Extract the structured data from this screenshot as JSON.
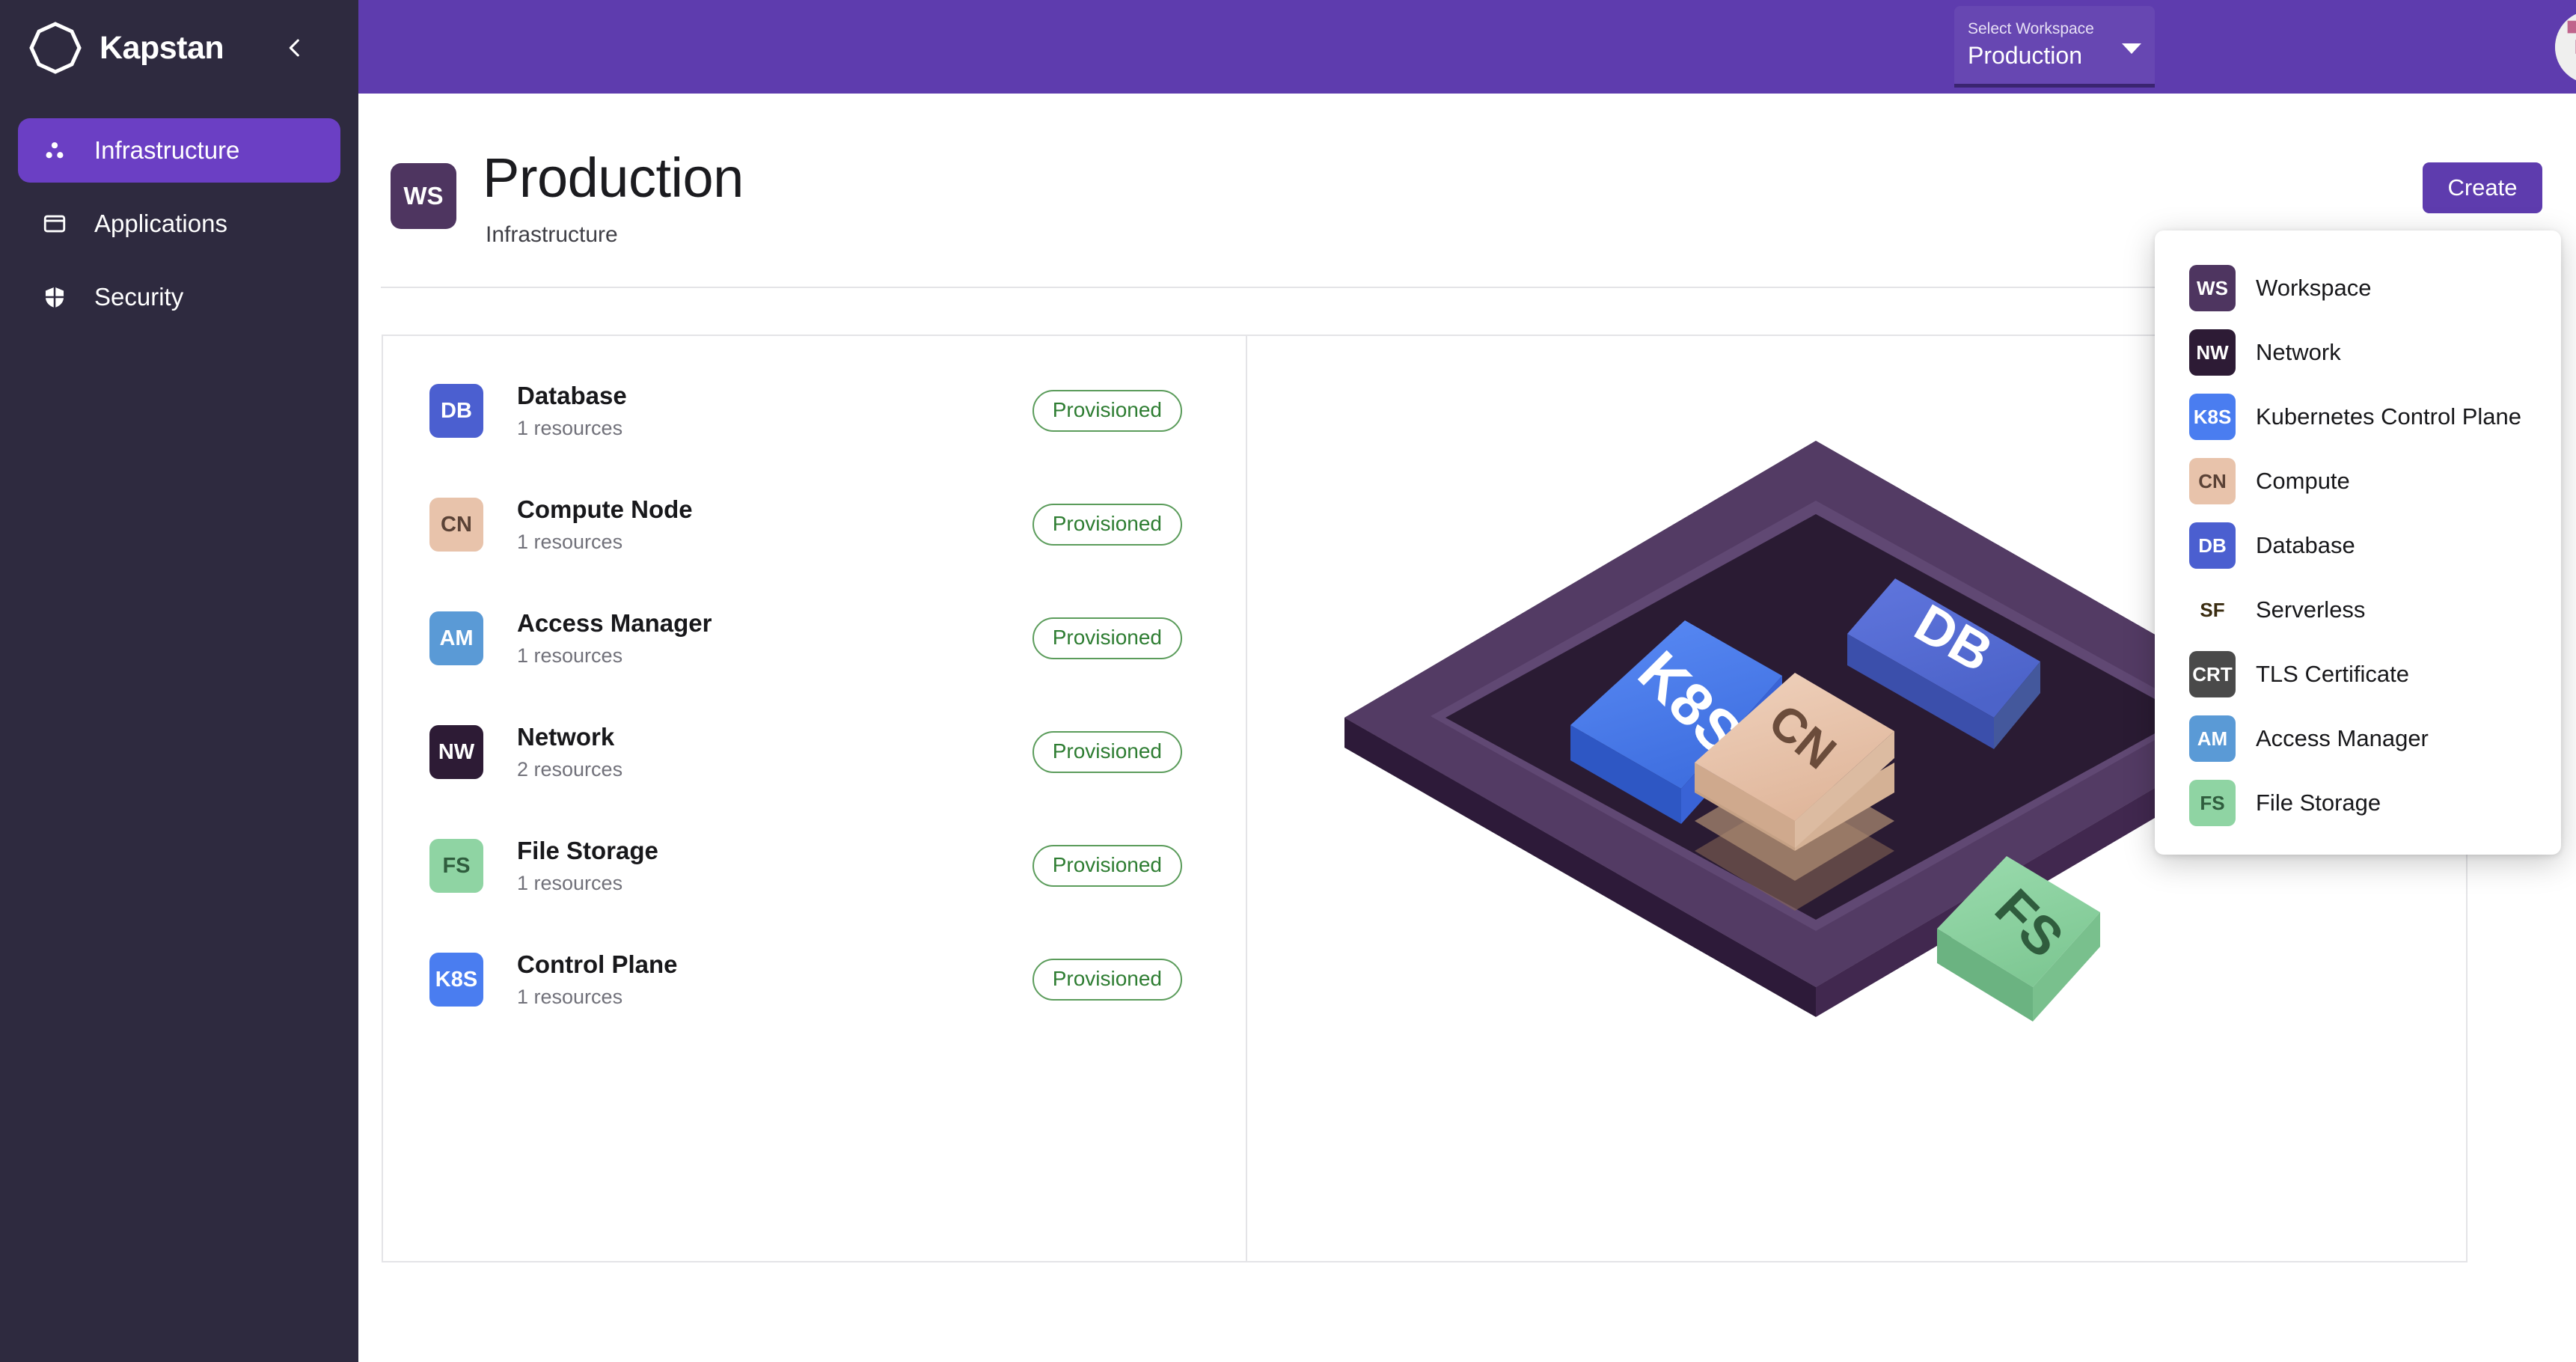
{
  "brand": {
    "name": "Kapstan",
    "logo_icon": "hexagon-ring-logo",
    "collapse_icon": "chevron-left-icon"
  },
  "sidebar": {
    "items": [
      {
        "label": "Infrastructure",
        "icon": "three-dots-cluster-icon",
        "active": true
      },
      {
        "label": "Applications",
        "icon": "window-icon",
        "active": false
      },
      {
        "label": "Security",
        "icon": "shield-icon",
        "active": false
      }
    ]
  },
  "header": {
    "workspace_label": "Select Workspace",
    "workspace_value": "Production",
    "caret_icon": "chevron-down-icon",
    "avatar_icon": "user-identicon-avatar",
    "bar_color": "#5e3cae"
  },
  "page": {
    "badge": "WS",
    "title": "Production",
    "subtitle": "Infrastructure",
    "create_label": "Create"
  },
  "resources": {
    "items": [
      {
        "badge": "DB",
        "name": "Database",
        "count": "1 resources",
        "status": "Provisioned",
        "badge_bg": "#4b5fd0",
        "badge_fg": "#ffffff"
      },
      {
        "badge": "CN",
        "name": "Compute Node",
        "count": "1 resources",
        "status": "Provisioned",
        "badge_bg": "#e8c3ab",
        "badge_fg": "#5a4236"
      },
      {
        "badge": "AM",
        "name": "Access Manager",
        "count": "1 resources",
        "status": "Provisioned",
        "badge_bg": "#5a9ad6",
        "badge_fg": "#ffffff"
      },
      {
        "badge": "NW",
        "name": "Network",
        "count": "2 resources",
        "status": "Provisioned",
        "badge_bg": "#2d1b35",
        "badge_fg": "#ffffff"
      },
      {
        "badge": "FS",
        "name": "File Storage",
        "count": "1 resources",
        "status": "Provisioned",
        "badge_bg": "#8fd4a3",
        "badge_fg": "#2f5c3d"
      },
      {
        "badge": "K8S",
        "name": "Control Plane",
        "count": "1 resources",
        "status": "Provisioned",
        "badge_bg": "#4a7df0",
        "badge_fg": "#ffffff"
      }
    ],
    "status_color": "#2e7d32"
  },
  "create_menu": {
    "items": [
      {
        "badge": "WS",
        "label": "Workspace",
        "badge_bg": "#4e3560",
        "badge_fg": "#ffffff"
      },
      {
        "badge": "NW",
        "label": "Network",
        "badge_bg": "#2d1b35",
        "badge_fg": "#ffffff"
      },
      {
        "badge": "K8S",
        "label": "Kubernetes Control Plane",
        "badge_bg": "#4a7df0",
        "badge_fg": "#ffffff"
      },
      {
        "badge": "CN",
        "label": "Compute",
        "badge_bg": "#e8c3ab",
        "badge_fg": "#5a4236"
      },
      {
        "badge": "DB",
        "label": "Database",
        "badge_bg": "#4b5fd0",
        "badge_fg": "#ffffff"
      },
      {
        "badge": "SF",
        "label": "Serverless",
        "badge_bg": "#f5c濃66",
        "badge_fg": "#3a2c10"
      },
      {
        "badge": "CRT",
        "label": "TLS Certificate",
        "badge_bg": "#4a4a4a",
        "badge_fg": "#ffffff"
      },
      {
        "badge": "AM",
        "label": "Access Manager",
        "badge_bg": "#5a9ad6",
        "badge_fg": "#ffffff"
      },
      {
        "badge": "FS",
        "label": "File Storage",
        "badge_bg": "#8fd4a3",
        "badge_fg": "#2f5c3d"
      }
    ]
  },
  "diagram": {
    "platform_color": "#4a3358",
    "blocks": [
      {
        "label": "K8S",
        "color": "#4a7df0"
      },
      {
        "label": "DB",
        "color": "#5570d8"
      },
      {
        "label": "CN",
        "color": "#e8c3ab"
      },
      {
        "label": "FS",
        "color": "#8fd4a3"
      }
    ]
  }
}
